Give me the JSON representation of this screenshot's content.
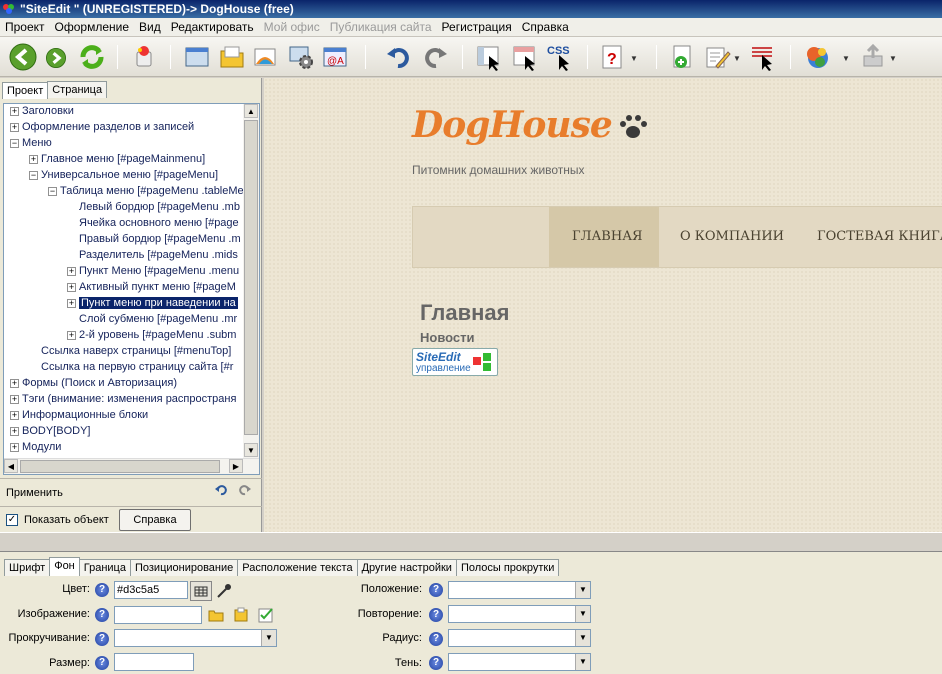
{
  "window": {
    "title": "\"SiteEdit \" (UNREGISTERED)-> DogHouse (free)"
  },
  "menu": {
    "items": [
      {
        "label": "Проект",
        "enabled": true
      },
      {
        "label": "Оформление",
        "enabled": true
      },
      {
        "label": "Вид",
        "enabled": true
      },
      {
        "label": "Редактировать",
        "enabled": true
      },
      {
        "label": "Мой офис",
        "enabled": false
      },
      {
        "label": "Публикация сайта",
        "enabled": false
      },
      {
        "label": "Регистрация",
        "enabled": true
      },
      {
        "label": "Справка",
        "enabled": true
      }
    ]
  },
  "toolbar": {
    "css_label": "CSS"
  },
  "left_panel": {
    "tabs": [
      "Проект",
      "Страница"
    ],
    "tree": [
      {
        "label": "Заголовки",
        "level": 0,
        "toggle": "+"
      },
      {
        "label": "Оформление разделов и записей",
        "level": 0,
        "toggle": "+"
      },
      {
        "label": "Меню",
        "level": 0,
        "toggle": "-"
      },
      {
        "label": "Главное меню [#pageMainmenu]",
        "level": 1,
        "toggle": "+"
      },
      {
        "label": "Универсальное меню  [#pageMenu]",
        "level": 1,
        "toggle": "-"
      },
      {
        "label": "Таблица меню [#pageMenu .tableMe",
        "level": 2,
        "toggle": "-"
      },
      {
        "label": "Левый бордюр [#pageMenu .mb",
        "level": 3,
        "toggle": ""
      },
      {
        "label": "Ячейка основного меню [#page",
        "level": 3,
        "toggle": ""
      },
      {
        "label": "Правый бордюр [#pageMenu .m",
        "level": 3,
        "toggle": ""
      },
      {
        "label": "Разделитель [#pageMenu .mids",
        "level": 3,
        "toggle": ""
      },
      {
        "label": "Пункт Меню [#pageMenu .menu",
        "level": 3,
        "toggle": "+"
      },
      {
        "label": "Активный пункт меню  [#pageM",
        "level": 3,
        "toggle": "+"
      },
      {
        "label": "Пункт меню при наведении на",
        "level": 3,
        "toggle": "+",
        "selected": true
      },
      {
        "label": "Слой субменю [#pageMenu .mr",
        "level": 3,
        "toggle": ""
      },
      {
        "label": "2-й уровень [#pageMenu .subm",
        "level": 3,
        "toggle": "+"
      },
      {
        "label": "Ссылка наверх страницы [#menuTop]",
        "level": 1,
        "toggle": ""
      },
      {
        "label": "Ссылка на первую страницу сайта [#r",
        "level": 1,
        "toggle": ""
      },
      {
        "label": "Формы (Поиск и Авторизация)",
        "level": 0,
        "toggle": "+"
      },
      {
        "label": "Тэги (внимание: изменения распространя",
        "level": 0,
        "toggle": "+"
      },
      {
        "label": "Информационные блоки",
        "level": 0,
        "toggle": "+"
      },
      {
        "label": "BODY[BODY]",
        "level": 0,
        "toggle": "+"
      },
      {
        "label": "Модули",
        "level": 0,
        "toggle": "+"
      }
    ],
    "apply_label": "Применить",
    "show_object_label": "Показать объект",
    "show_object_checked": "✓",
    "help_button": "Справка"
  },
  "preview": {
    "logo": "DogHouse",
    "tagline": "Питомник домашних животных",
    "nav": [
      "ГЛАВНАЯ",
      "О КОМПАНИИ",
      "ГОСТЕВАЯ КНИГА"
    ],
    "heading": "Главная",
    "subheading": "Новости",
    "badge_title": "SiteEdit",
    "badge_sub": "управление"
  },
  "properties": {
    "tabs": [
      "Шрифт",
      "Фон",
      "Граница",
      "Позиционирование",
      "Расположение текста",
      "Другие настройки",
      "Полосы прокрутки"
    ],
    "active_tab": "Фон",
    "left_fields": {
      "color_label": "Цвет:",
      "color_value": "#d3c5a5",
      "image_label": "Изображение:",
      "scroll_label": "Прокручивание:",
      "size_label": "Размер:"
    },
    "right_fields": {
      "position_label": "Положение:",
      "repeat_label": "Повторение:",
      "radius_label": "Радиус:",
      "shadow_label": "Тень:"
    },
    "help_glyph": "?"
  }
}
